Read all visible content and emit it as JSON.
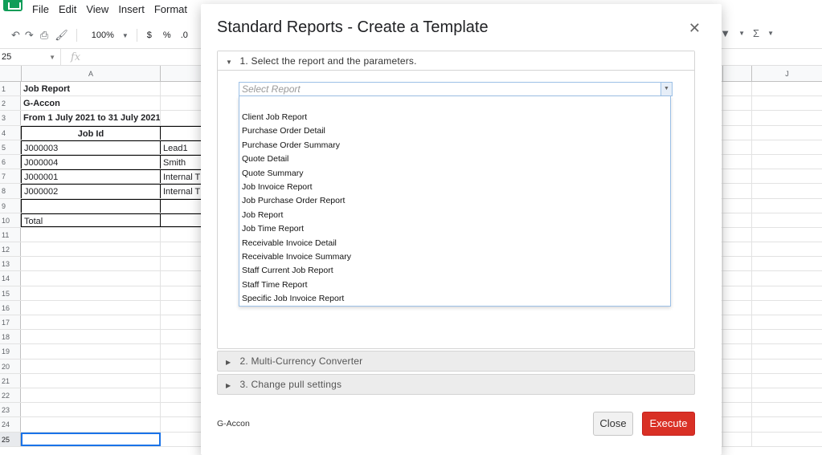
{
  "menubar": [
    "File",
    "Edit",
    "View",
    "Insert",
    "Format"
  ],
  "toolbar": {
    "zoom": "100%",
    "currency": "$",
    "percent": "%",
    "decimal": ".0"
  },
  "formula_bar": {
    "cell_ref": "25",
    "fx": "fx"
  },
  "columns": {
    "a": "A",
    "j": "J"
  },
  "sheet_rows": [
    {
      "n": "1",
      "a": "Job Report",
      "b": ""
    },
    {
      "n": "2",
      "a": "G-Accon",
      "b": ""
    },
    {
      "n": "3",
      "a": "From 1 July 2021 to 31 July 2021",
      "b": ""
    },
    {
      "n": "4",
      "a": "Job Id",
      "b": ""
    },
    {
      "n": "5",
      "a": "J000003",
      "b": "Lead1"
    },
    {
      "n": "6",
      "a": "J000004",
      "b": "Smith"
    },
    {
      "n": "7",
      "a": "J000001",
      "b": "Internal T"
    },
    {
      "n": "8",
      "a": "J000002",
      "b": "Internal T"
    },
    {
      "n": "9",
      "a": "",
      "b": ""
    },
    {
      "n": "10",
      "a": "Total",
      "b": ""
    },
    {
      "n": "11",
      "a": "",
      "b": ""
    },
    {
      "n": "12",
      "a": "",
      "b": ""
    },
    {
      "n": "13",
      "a": "",
      "b": ""
    },
    {
      "n": "14",
      "a": "",
      "b": ""
    },
    {
      "n": "15",
      "a": "",
      "b": ""
    },
    {
      "n": "16",
      "a": "",
      "b": ""
    },
    {
      "n": "17",
      "a": "",
      "b": ""
    },
    {
      "n": "18",
      "a": "",
      "b": ""
    },
    {
      "n": "19",
      "a": "",
      "b": ""
    },
    {
      "n": "20",
      "a": "",
      "b": ""
    },
    {
      "n": "21",
      "a": "",
      "b": ""
    },
    {
      "n": "22",
      "a": "",
      "b": ""
    },
    {
      "n": "23",
      "a": "",
      "b": ""
    },
    {
      "n": "24",
      "a": "",
      "b": ""
    },
    {
      "n": "25",
      "a": "",
      "b": ""
    }
  ],
  "dialog": {
    "title": "Standard Reports - Create a Template",
    "close_symbol": "✕",
    "sections": [
      {
        "label": "1. Select the report and the parameters.",
        "expanded": true
      },
      {
        "label": "2. Multi-Currency Converter",
        "expanded": false
      },
      {
        "label": "3. Change pull settings",
        "expanded": false
      }
    ],
    "select": {
      "placeholder": "Select Report",
      "options": [
        "Client Job Report",
        "Purchase Order Detail",
        "Purchase Order Summary",
        "Quote Detail",
        "Quote Summary",
        "Job Invoice Report",
        "Job Purchase Order Report",
        "Job Report",
        "Job Time Report",
        "Receivable Invoice Detail",
        "Receivable Invoice Summary",
        "Staff Current Job Report",
        "Staff Time Report",
        "Specific Job Invoice Report"
      ]
    },
    "footer_brand": "G-Accon",
    "close_button": "Close",
    "execute_button": "Execute",
    "colors": {
      "execute_bg": "#d93025",
      "select_border": "#9cc0e6"
    }
  }
}
